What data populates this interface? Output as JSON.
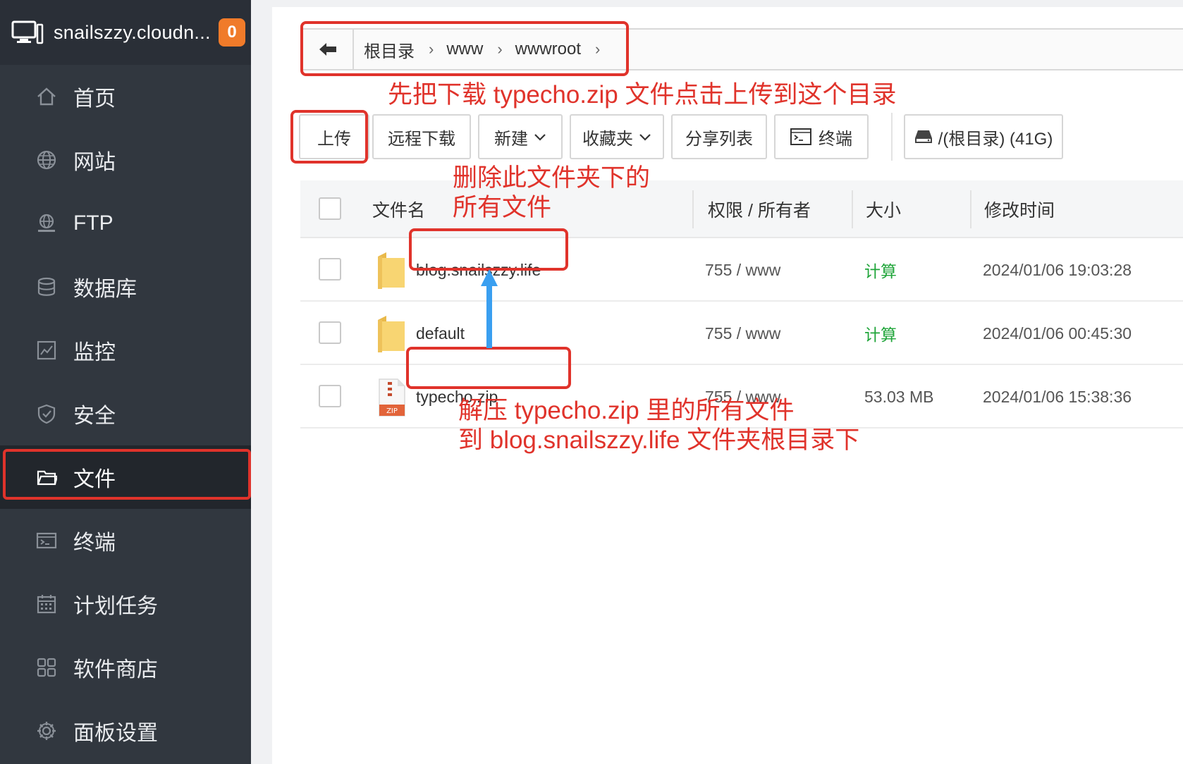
{
  "sidebar": {
    "host": "snailszzy.cloudn...",
    "badge": "0",
    "items": [
      {
        "label": "首页",
        "icon": "home-icon"
      },
      {
        "label": "网站",
        "icon": "globe-icon"
      },
      {
        "label": "FTP",
        "icon": "ftp-icon"
      },
      {
        "label": "数据库",
        "icon": "database-icon"
      },
      {
        "label": "监控",
        "icon": "monitor-chart-icon"
      },
      {
        "label": "安全",
        "icon": "shield-icon"
      },
      {
        "label": "文件",
        "icon": "folder-icon",
        "active": true
      },
      {
        "label": "终端",
        "icon": "terminal-icon"
      },
      {
        "label": "计划任务",
        "icon": "calendar-icon"
      },
      {
        "label": "软件商店",
        "icon": "apps-grid-icon"
      },
      {
        "label": "面板设置",
        "icon": "gear-icon"
      }
    ]
  },
  "breadcrumb": {
    "items": [
      "根目录",
      "www",
      "wwwroot"
    ]
  },
  "toolbar": {
    "upload": "上传",
    "remote_download": "远程下载",
    "new": "新建",
    "favorites": "收藏夹",
    "share_list": "分享列表",
    "terminal": "终端",
    "disk": "/(根目录) (41G)"
  },
  "table": {
    "headers": {
      "name": "文件名",
      "perm": "权限 / 所有者",
      "size": "大小",
      "mtime": "修改时间"
    },
    "rows": [
      {
        "name": "blog.snailszzy.life",
        "type": "folder",
        "perm": "755 / www",
        "size": "计算",
        "mtime": "2024/01/06 19:03:28"
      },
      {
        "name": "default",
        "type": "folder",
        "perm": "755 / www",
        "size": "计算",
        "mtime": "2024/01/06 00:45:30"
      },
      {
        "name": "typecho.zip",
        "type": "zip",
        "perm": "755 / www",
        "size": "53.03 MB",
        "mtime": "2024/01/06 15:38:36"
      }
    ]
  },
  "annotations": {
    "upload_note": "先把下载 typecho.zip 文件点击上传到这个目录",
    "delete_note_1": "删除此文件夹下的",
    "delete_note_2": "所有文件",
    "unzip_note_1": "解压 typecho.zip 里的所有文件",
    "unzip_note_2": "到 blog.snailszzy.life 文件夹根目录下"
  },
  "colors": {
    "annotation": "#e0332b",
    "arrow": "#3a9ff0",
    "badge": "#f07b2a",
    "size_link": "#20a53a"
  }
}
